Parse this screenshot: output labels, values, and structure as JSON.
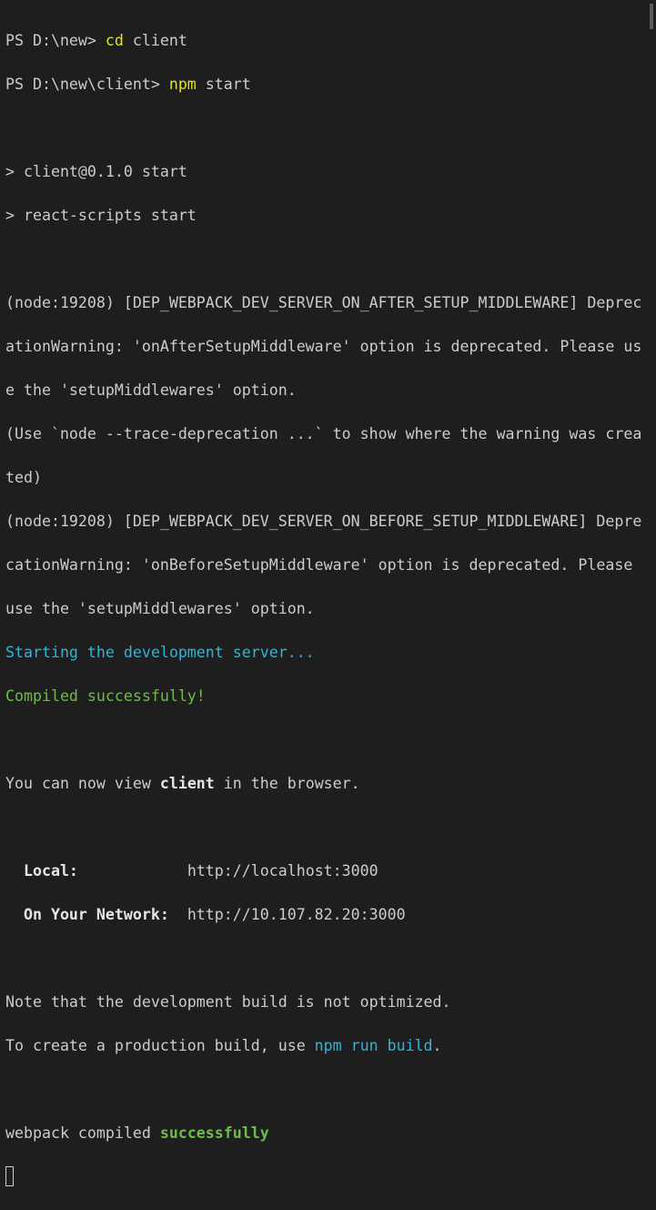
{
  "terminal": {
    "l1_prompt": "PS D:\\new> ",
    "l1_cmd": "cd",
    "l1_arg": " client",
    "l2_prompt": "PS D:\\new\\client> ",
    "l2_cmd": "npm",
    "l2_arg": " start",
    "l4": "> client@0.1.0 start",
    "l5": "> react-scripts start",
    "l7": "(node:19208) [DEP_WEBPACK_DEV_SERVER_ON_AFTER_SETUP_MIDDLEWARE] Deprec",
    "l8": "ationWarning: 'onAfterSetupMiddleware' option is deprecated. Please us",
    "l9": "e the 'setupMiddlewares' option.",
    "l10": "(Use `node --trace-deprecation ...` to show where the warning was crea",
    "l11": "ted)",
    "l12": "(node:19208) [DEP_WEBPACK_DEV_SERVER_ON_BEFORE_SETUP_MIDDLEWARE] Depre",
    "l13": "cationWarning: 'onBeforeSetupMiddleware' option is deprecated. Please",
    "l14": "use the 'setupMiddlewares' option.",
    "l15": "Starting the development server...",
    "l16": "Compiled successfully!",
    "l18_a": "You can now view ",
    "l18_b": "client",
    "l18_c": " in the browser.",
    "l20_label": "  Local:",
    "l20_pad": "            ",
    "l20_url": "http://localhost:3000",
    "l21_label": "  On Your Network:",
    "l21_pad": "  ",
    "l21_url": "http://10.107.82.20:3000",
    "l23": "Note that the development build is not optimized.",
    "l24_a": "To create a production build, use ",
    "l24_b": "npm run build",
    "l24_c": ".",
    "l26_a": "webpack compiled ",
    "l26_b": "successfully"
  },
  "colors": {
    "background": "#1e1e1e",
    "text": "#cccccc",
    "command_yellow": "#e5e510",
    "cyan": "#29b8db",
    "green": "#6dbd47"
  }
}
